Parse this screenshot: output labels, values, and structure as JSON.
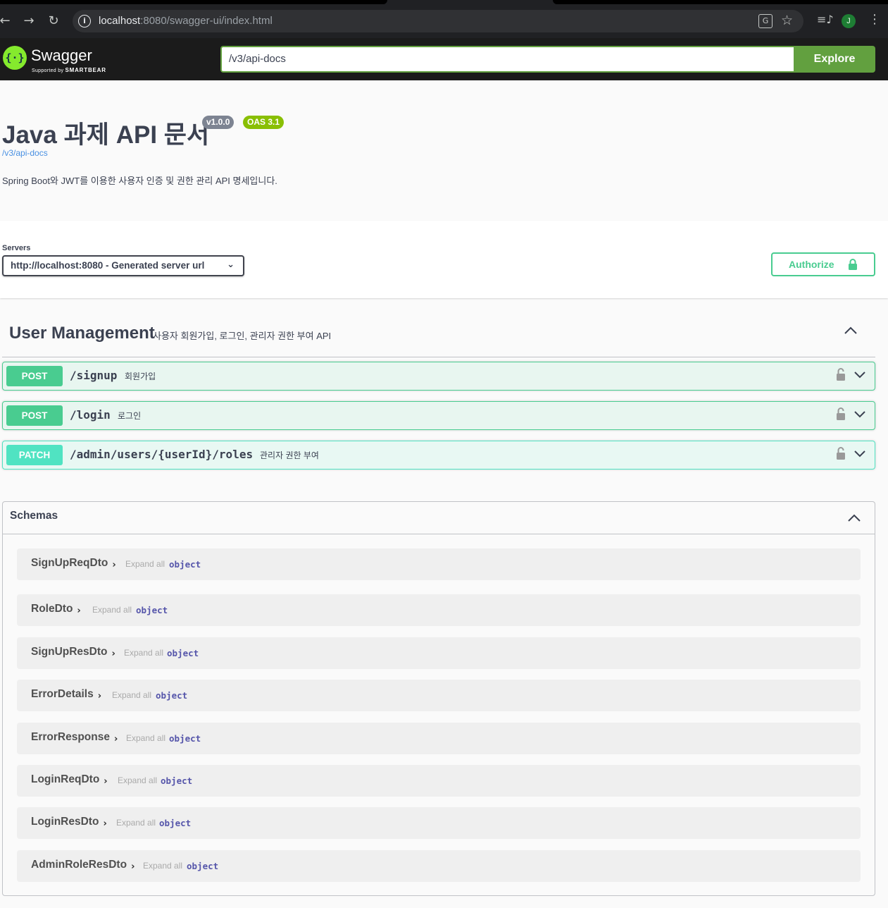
{
  "browser": {
    "url_host": "localhost",
    "url_rest": ":8080/swagger-ui/index.html",
    "profile_initial": "J"
  },
  "topbar": {
    "logo_text": "Swagger",
    "logo_sub_prefix": "Supported by",
    "logo_sub_brand": "SMARTBEAR",
    "spec_url": "/v3/api-docs",
    "explore_label": "Explore"
  },
  "info": {
    "title": "Java 과제 API 문서",
    "version": "v1.0.0",
    "oas": "OAS 3.1",
    "spec_link": "/v3/api-docs",
    "description": "Spring Boot와 JWT를 이용한 사용자 인증 및 권한 관리 API 명세입니다."
  },
  "servers": {
    "label": "Servers",
    "selected": "http://localhost:8080 - Generated server url",
    "authorize_label": "Authorize"
  },
  "tag": {
    "name": "User Management",
    "description": "사용자 회원가입, 로그인, 관리자 권한 부여 API",
    "operations": [
      {
        "method": "POST",
        "path": "/signup",
        "summary": "회원가입"
      },
      {
        "method": "POST",
        "path": "/login",
        "summary": "로그인"
      },
      {
        "method": "PATCH",
        "path": "/admin/users/{userId}/roles",
        "summary": "관리자 권한 부여"
      }
    ]
  },
  "schemas": {
    "title": "Schemas",
    "expand_all_label": "Expand all",
    "type_label": "object",
    "items": [
      {
        "name": "SignUpReqDto"
      },
      {
        "name": "RoleDto"
      },
      {
        "name": "SignUpResDto"
      },
      {
        "name": "ErrorDetails"
      },
      {
        "name": "ErrorResponse"
      },
      {
        "name": "LoginReqDto"
      },
      {
        "name": "LoginResDto"
      },
      {
        "name": "AdminRoleResDto"
      }
    ]
  },
  "colors": {
    "post": "#49cc90",
    "patch": "#50e3c2",
    "explore": "#62a03f",
    "logo": "#85ea2d"
  }
}
